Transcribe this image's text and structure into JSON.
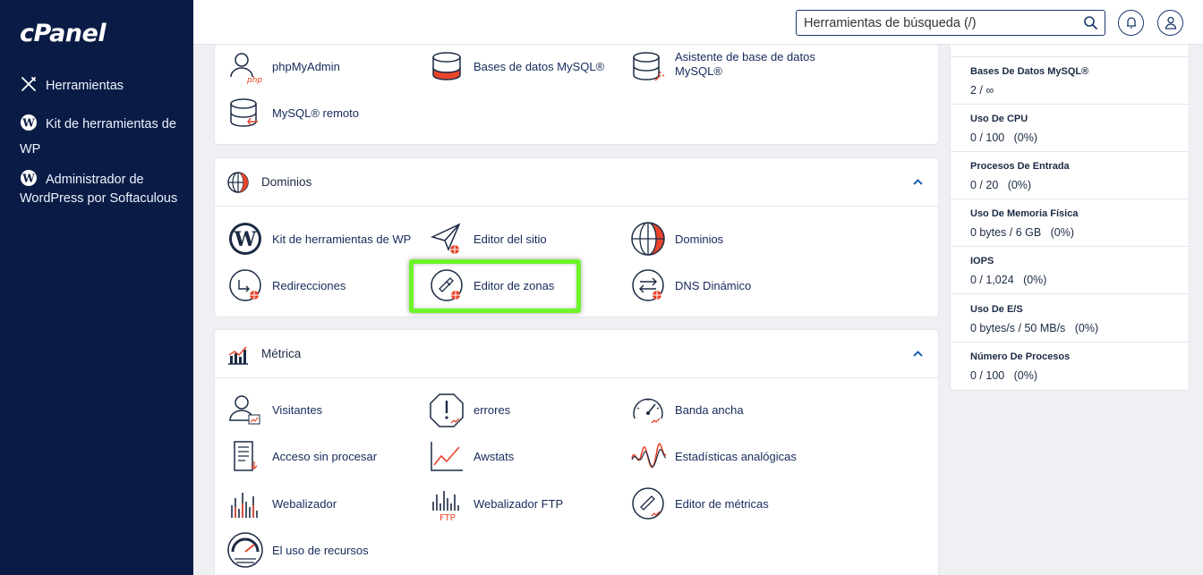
{
  "sidebar": {
    "logo": "cPanel",
    "items": [
      {
        "label": "Herramientas"
      },
      {
        "label": "Kit de herramientas de WP"
      },
      {
        "label": "Administrador de WordPress por Softaculous"
      }
    ]
  },
  "topbar": {
    "search_placeholder": "Herramientas de búsqueda (/)"
  },
  "databases": {
    "tools": [
      {
        "label": "phpMyAdmin"
      },
      {
        "label": "Bases de datos MySQL®"
      },
      {
        "label": "Asistente de base de datos MySQL®"
      },
      {
        "label": "MySQL® remoto"
      }
    ]
  },
  "domains": {
    "title": "Dominios",
    "tools": [
      {
        "label": "Kit de herramientas de WP"
      },
      {
        "label": "Editor del sitio"
      },
      {
        "label": "Dominios"
      },
      {
        "label": "Redirecciones"
      },
      {
        "label": "Editor de zonas"
      },
      {
        "label": "DNS Dinámico"
      }
    ]
  },
  "metrics": {
    "title": "Métrica",
    "tools": [
      {
        "label": "Visitantes"
      },
      {
        "label": "errores"
      },
      {
        "label": "Banda ancha"
      },
      {
        "label": "Acceso sin procesar"
      },
      {
        "label": "Awstats"
      },
      {
        "label": "Estadísticas analógicas"
      },
      {
        "label": "Webalizador"
      },
      {
        "label": "Webalizador FTP"
      },
      {
        "label": "Editor de métricas"
      },
      {
        "label": "El uso de recursos"
      }
    ]
  },
  "stats": [
    {
      "label": "Bases De Datos MySQL®",
      "value": "2 / ∞"
    },
    {
      "label": "Uso De CPU",
      "value": "0 / 100   (0%)"
    },
    {
      "label": "Procesos De Entrada",
      "value": "0 / 20   (0%)"
    },
    {
      "label": "Uso De Memoria Física",
      "value": "0 bytes / 6 GB   (0%)"
    },
    {
      "label": "IOPS",
      "value": "0 / 1,024   (0%)"
    },
    {
      "label": "Uso De E/S",
      "value": "0 bytes/s / 50 MB/s   (0%)"
    },
    {
      "label": "Número De Procesos",
      "value": "0 / 100   (0%)"
    }
  ],
  "colors": {
    "sidebar_bg": "#0a1c45",
    "accent_red": "#e8452c",
    "link_blue": "#16295a",
    "highlight_green": "#6cf52a"
  }
}
